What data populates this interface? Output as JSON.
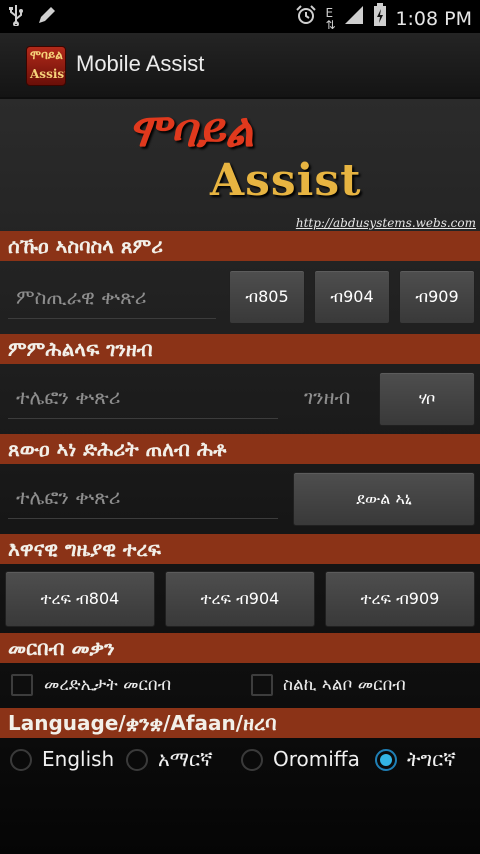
{
  "status_bar": {
    "time": "1:08 PM",
    "icons": [
      "usb-icon",
      "pen-icon",
      "alarm-icon",
      "data-e-icon",
      "signal-icon",
      "battery-charging-icon"
    ]
  },
  "action_bar": {
    "logo_line1": "ሞባይል",
    "logo_line2": "Assist",
    "title": "Mobile Assist"
  },
  "banner": {
    "title_amharic": "ሞባይል",
    "title_english": "Assist",
    "url": "http://abdusystems.webs.com"
  },
  "section1": {
    "header": "ሰኹዐ ኣስባስላ ጸምሪ",
    "input_placeholder": "ምስጢራዊ ቍጽሪ",
    "buttons": [
      "ብ805",
      "ብ904",
      "ብ909"
    ]
  },
  "section2": {
    "header": "ምምሕልላፍ ገንዘብ",
    "phone_placeholder": "ተሌፎን ቍጽሪ",
    "amount_label": "ገንዘብ",
    "button": "ሃቦ"
  },
  "section3": {
    "header": "ጸውዐ ኣነ ድሕሪት ጠለብ ሕቶ",
    "phone_placeholder": "ተሌፎን ቍጽሪ",
    "button": "ደውል ኣኒ"
  },
  "section4": {
    "header": "እዋናዊ ግዜያዊ ተረፍ",
    "buttons": [
      "ተረፍ ብ804",
      "ተረፍ ብ904",
      "ተረፍ ብ909"
    ]
  },
  "section5": {
    "header": "መርበብ መቃን",
    "checkbox1": "መረድኢታት መርበብ",
    "checkbox2": "ስልኪ ኣልቦ መርበብ"
  },
  "section6": {
    "header": "Language/ቋንቋ/Afaan/ዘረባ",
    "options": [
      "English",
      "አማርኛ",
      "Oromiffa",
      "ትግርኛ"
    ],
    "selected": "ትግርኛ"
  },
  "colors": {
    "section_header_bg": "#8b3317",
    "radio_selected": "#33b5e5",
    "banner_red": "#e0391d",
    "banner_gold": "#e7b441"
  }
}
